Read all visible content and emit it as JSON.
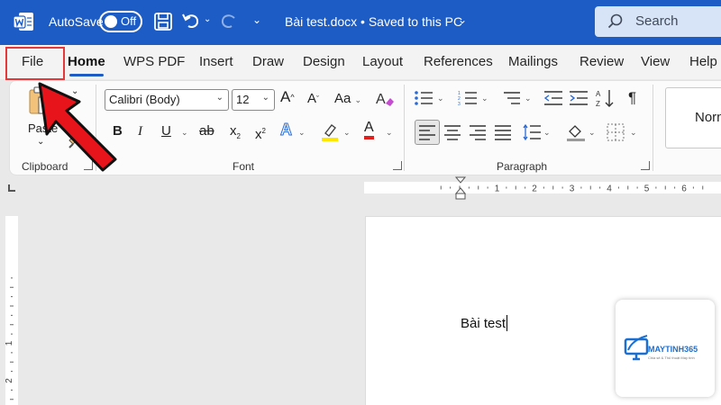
{
  "titlebar": {
    "autosave_label": "AutoSave",
    "autosave_state": "Off",
    "document_title": "Bài test.docx • Saved to this PC",
    "search_label": "Search",
    "colors": {
      "bar": "#1d5cc4",
      "search_bg": "#d7e4f7"
    }
  },
  "tabs": [
    {
      "label": "File"
    },
    {
      "label": "Home",
      "active": true
    },
    {
      "label": "WPS PDF"
    },
    {
      "label": "Insert"
    },
    {
      "label": "Draw"
    },
    {
      "label": "Design"
    },
    {
      "label": "Layout"
    },
    {
      "label": "References"
    },
    {
      "label": "Mailings"
    },
    {
      "label": "Review"
    },
    {
      "label": "View"
    },
    {
      "label": "Help"
    }
  ],
  "ribbon": {
    "clipboard": {
      "paste_label": "Paste",
      "group_label": "Clipboard"
    },
    "font": {
      "font_name": "Calibri (Body)",
      "font_size": "12",
      "bold": "B",
      "italic": "I",
      "underline": "U",
      "strikethrough": "ab",
      "subscript": "x",
      "superscript": "x",
      "case_label": "Aa",
      "grow_label": "A",
      "shrink_label": "A",
      "text_effects_label": "A",
      "font_color_label": "A",
      "group_label": "Font"
    },
    "paragraph": {
      "pilcrow": "¶",
      "group_label": "Paragraph"
    },
    "styles": {
      "normal_label": "Norn"
    }
  },
  "ruler": {
    "numbers": [
      "1",
      "2",
      "3",
      "4",
      "5",
      "6"
    ],
    "vertical_numbers": [
      "1",
      "2"
    ]
  },
  "document": {
    "text": "Bài test"
  },
  "watermark": {
    "name": "MAYTINH365",
    "tagline": "Chia sẻ & Thủ thuật Máy tính"
  },
  "annotation": {
    "highlight_color": "#e5383b",
    "target": "File"
  }
}
